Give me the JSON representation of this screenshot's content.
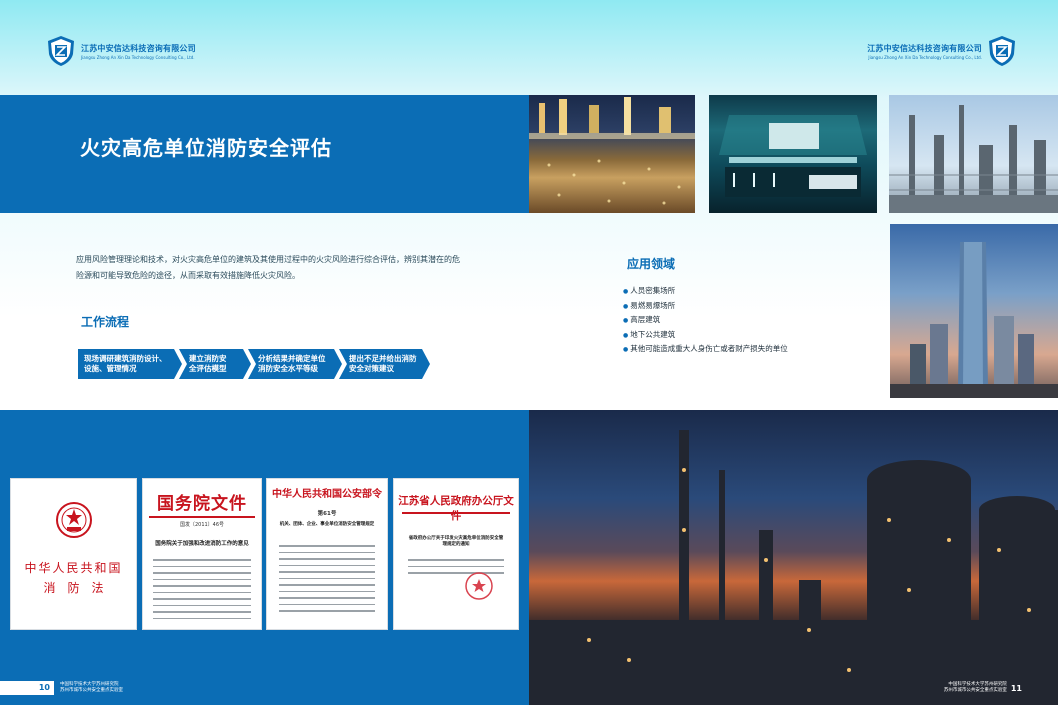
{
  "brand": {
    "name_cn": "江苏中安信达科技咨询有限公司",
    "name_en": "Jiangsu Zhong An Xin Da Technology Consulting Co., Ltd."
  },
  "left": {
    "title": "火灾高危单位消防安全评估",
    "intro": "应用风险管理理论和技术，对火灾高危单位的建筑及其使用过程中的火灾风险进行综合评估，辨别其潜在的危险源和可能导致危险的途径，从而采取有效措施降低火灾风险。",
    "workflow_heading": "工作流程",
    "steps": [
      {
        "line1": "现场调研建筑消防设计、",
        "line2": "设施、管理情况"
      },
      {
        "line1": "建立消防安",
        "line2": "全评估模型"
      },
      {
        "line1": "分析结果并确定单位",
        "line2": "消防安全水平等级"
      },
      {
        "line1": "提出不足并给出消防",
        "line2": "安全对策建议"
      }
    ],
    "docs": {
      "law": {
        "line1": "中华人民共和国",
        "line2": "消　防　法"
      },
      "state_council": {
        "head": "国务院文件",
        "num": "国发〔2011〕46号",
        "sub": "国务院关于加强和改进消防工作的意见"
      },
      "ministry": {
        "head": "中华人民共和国公安部令",
        "num": "第61号",
        "sub": "机关、团体、企业、事业单位消防安全管理规定"
      },
      "jiangsu": {
        "head": "江苏省人民政府办公厅文件",
        "sub": "省政府办公厅关于印发火灾高危单位消防安全管理规定的通知"
      }
    },
    "page_number": "10",
    "footer_line1": "中国科学技术大学苏州研究院",
    "footer_line2": "苏州市城市公共安全重点实验室"
  },
  "right": {
    "domain_heading": "应用领域",
    "domains": [
      "人员密集场所",
      "易燃易爆场所",
      "高层建筑",
      "地下公共建筑",
      "其他可能造成重大人身伤亡或者财产损失的单位"
    ],
    "page_number": "11",
    "footer_line1": "中国科学技术大学苏州研究院",
    "footer_line2": "苏州市城市公共安全重点实验室"
  }
}
